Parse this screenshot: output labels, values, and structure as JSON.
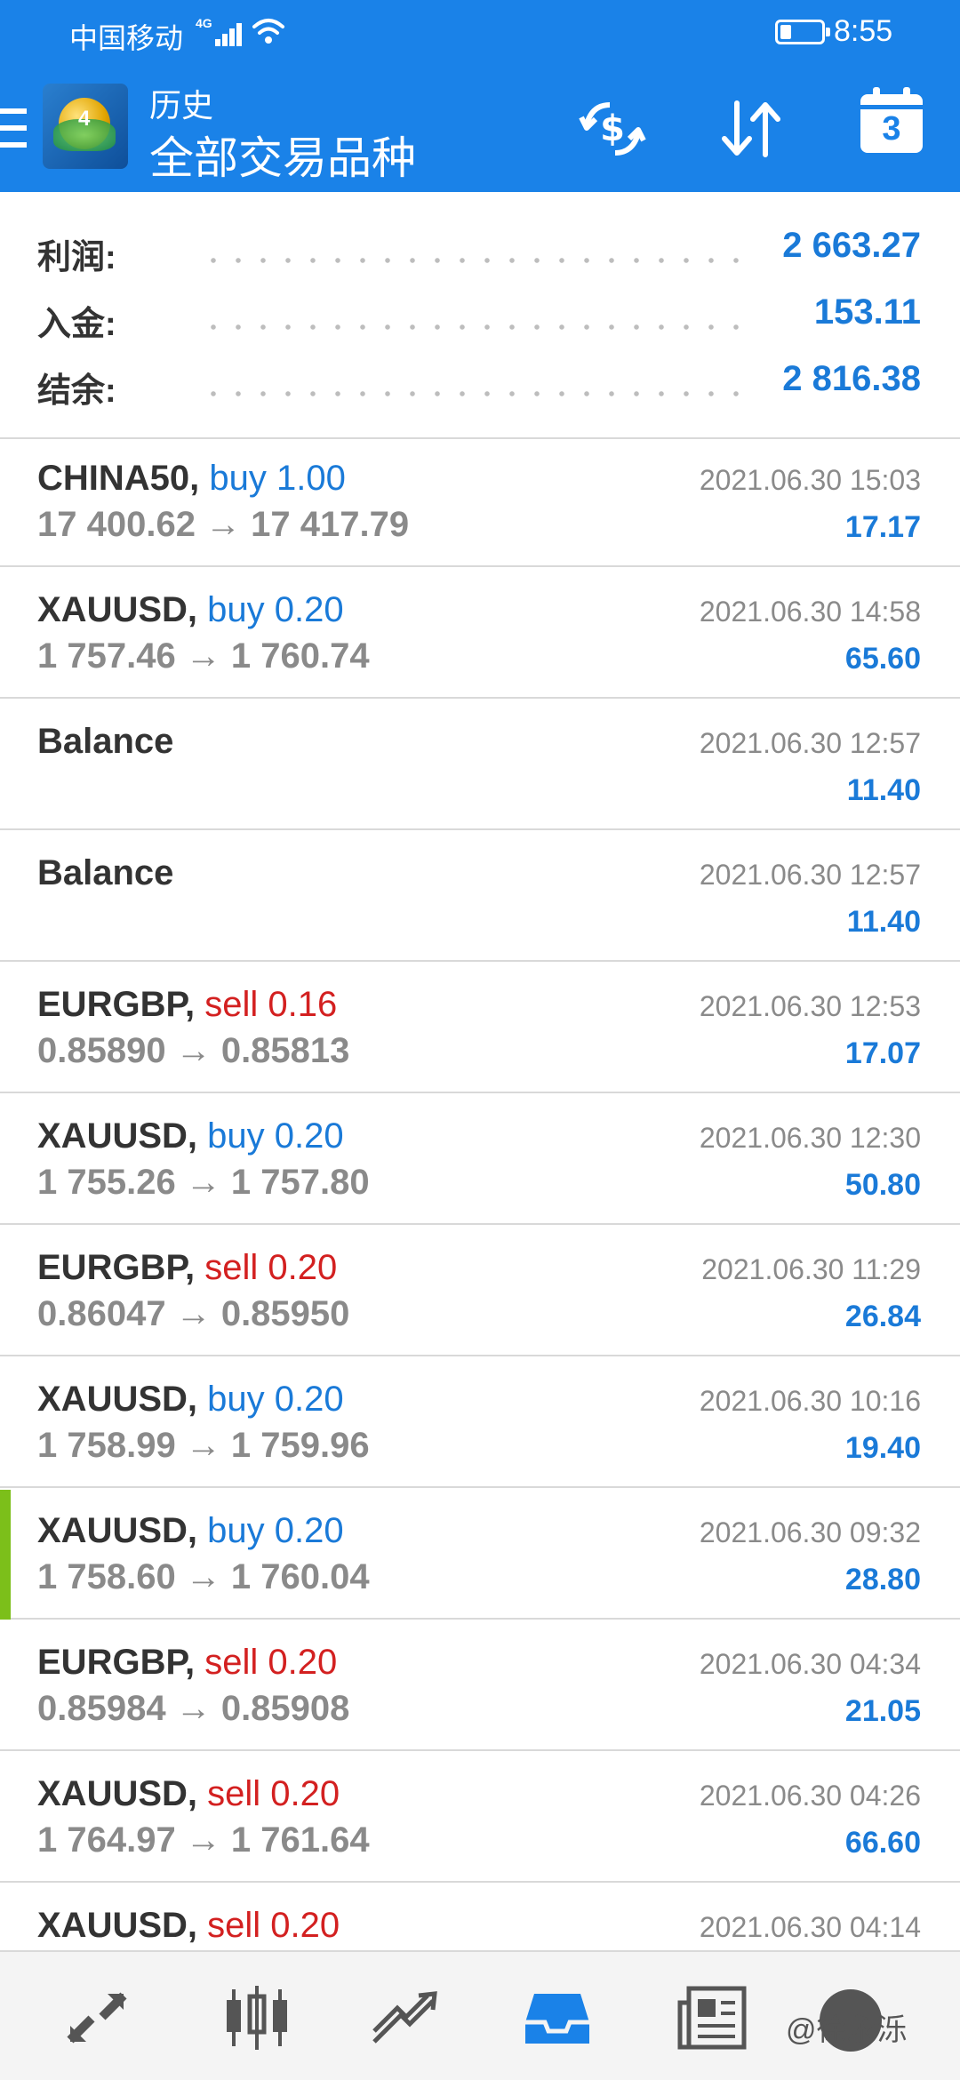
{
  "status_bar": {
    "carrier": "中国移动",
    "network": "4G",
    "time": "8:55"
  },
  "header": {
    "title": "历史",
    "subtitle": "全部交易品种",
    "calendar_day": "3",
    "icons": [
      "menu-icon",
      "mt4-logo",
      "deposit-withdraw-icon",
      "sort-icon",
      "calendar-icon"
    ]
  },
  "summary": {
    "profit_label": "利润:",
    "profit_value": "2 663.27",
    "deposit_label": "入金:",
    "deposit_value": "153.11",
    "balance_label": "结余:",
    "balance_value": "2 816.38"
  },
  "deals": [
    {
      "symbol": "CHINA50,",
      "side": "buy 1.00",
      "type": "buy",
      "prices": "17 400.62 → 17 417.79",
      "time": "2021.06.30 15:03",
      "profit": "17.17"
    },
    {
      "symbol": "XAUUSD,",
      "side": "buy 0.20",
      "type": "buy",
      "prices": "1 757.46 → 1 760.74",
      "time": "2021.06.30 14:58",
      "profit": "65.60"
    },
    {
      "symbol": "Balance",
      "side": "",
      "type": "balance",
      "prices": "",
      "time": "2021.06.30 12:57",
      "profit": "11.40"
    },
    {
      "symbol": "Balance",
      "side": "",
      "type": "balance",
      "prices": "",
      "time": "2021.06.30 12:57",
      "profit": "11.40"
    },
    {
      "symbol": "EURGBP,",
      "side": "sell 0.16",
      "type": "sell",
      "prices": "0.85890 → 0.85813",
      "time": "2021.06.30 12:53",
      "profit": "17.07"
    },
    {
      "symbol": "XAUUSD,",
      "side": "buy 0.20",
      "type": "buy",
      "prices": "1 755.26 → 1 757.80",
      "time": "2021.06.30 12:30",
      "profit": "50.80"
    },
    {
      "symbol": "EURGBP,",
      "side": "sell 0.20",
      "type": "sell",
      "prices": "0.86047 → 0.85950",
      "time": "2021.06.30 11:29",
      "profit": "26.84"
    },
    {
      "symbol": "XAUUSD,",
      "side": "buy 0.20",
      "type": "buy",
      "prices": "1 758.99 → 1 759.96",
      "time": "2021.06.30 10:16",
      "profit": "19.40"
    },
    {
      "symbol": "XAUUSD,",
      "side": "buy 0.20",
      "type": "buy",
      "prices": "1 758.60 → 1 760.04",
      "time": "2021.06.30 09:32",
      "profit": "28.80",
      "selected": true
    },
    {
      "symbol": "EURGBP,",
      "side": "sell 0.20",
      "type": "sell",
      "prices": "0.85984 → 0.85908",
      "time": "2021.06.30 04:34",
      "profit": "21.05"
    },
    {
      "symbol": "XAUUSD,",
      "side": "sell 0.20",
      "type": "sell",
      "prices": "1 764.97 → 1 761.64",
      "time": "2021.06.30 04:26",
      "profit": "66.60"
    },
    {
      "symbol": "XAUUSD,",
      "side": "sell 0.20",
      "type": "sell",
      "prices": "",
      "time": "2021.06.30 04:14",
      "profit": ""
    }
  ],
  "bottom_nav": {
    "items": [
      "quotes-icon",
      "chart-icon",
      "trade-icon",
      "history-icon",
      "news-icon",
      "messages-icon"
    ],
    "active": "history-icon",
    "watermark": "@徐永泺"
  },
  "colors": {
    "header_blue": "#1a82e8",
    "value_blue": "#1a7ad8",
    "sell_red": "#d32020",
    "selected_marker": "#7cbf1a"
  }
}
